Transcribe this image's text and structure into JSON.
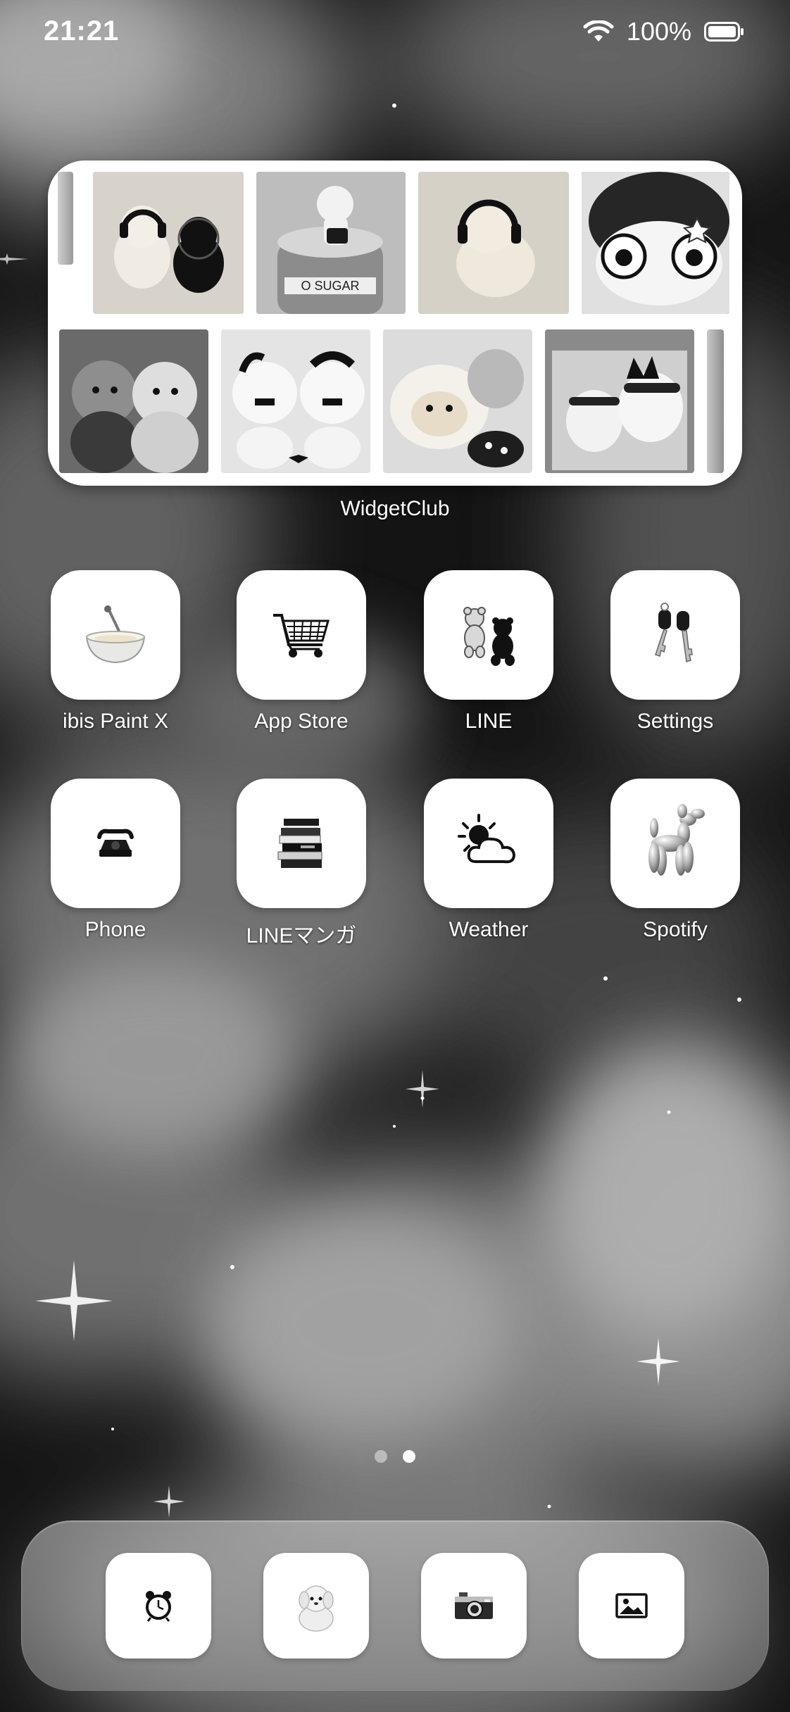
{
  "status_bar": {
    "time": "21:21",
    "battery_percent": "100%",
    "wifi_icon": "wifi-icon",
    "battery_icon": "battery-full-icon"
  },
  "widget": {
    "label": "WidgetClub"
  },
  "home_apps": [
    {
      "label": "ibis Paint X",
      "icon": "mixing-bowl-icon"
    },
    {
      "label": "App Store",
      "icon": "shopping-cart-icon"
    },
    {
      "label": "LINE",
      "icon": "teddy-bears-icon"
    },
    {
      "label": "Settings",
      "icon": "car-keys-icon"
    },
    {
      "label": "Phone",
      "icon": "rotary-phone-icon"
    },
    {
      "label": "LINEマンガ",
      "icon": "book-stack-icon"
    },
    {
      "label": "Weather",
      "icon": "sun-cloud-icon"
    },
    {
      "label": "Spotify",
      "icon": "balloon-dog-icon"
    }
  ],
  "page_indicator": {
    "total": 2,
    "current": 2
  },
  "dock_apps": [
    {
      "icon": "alarm-clock-icon"
    },
    {
      "icon": "plush-dog-icon"
    },
    {
      "icon": "camera-icon"
    },
    {
      "icon": "photos-icon"
    }
  ],
  "colors": {
    "widget_bg": "#ffffff",
    "text": "#ffffff",
    "dock": "#a8a8a8"
  }
}
